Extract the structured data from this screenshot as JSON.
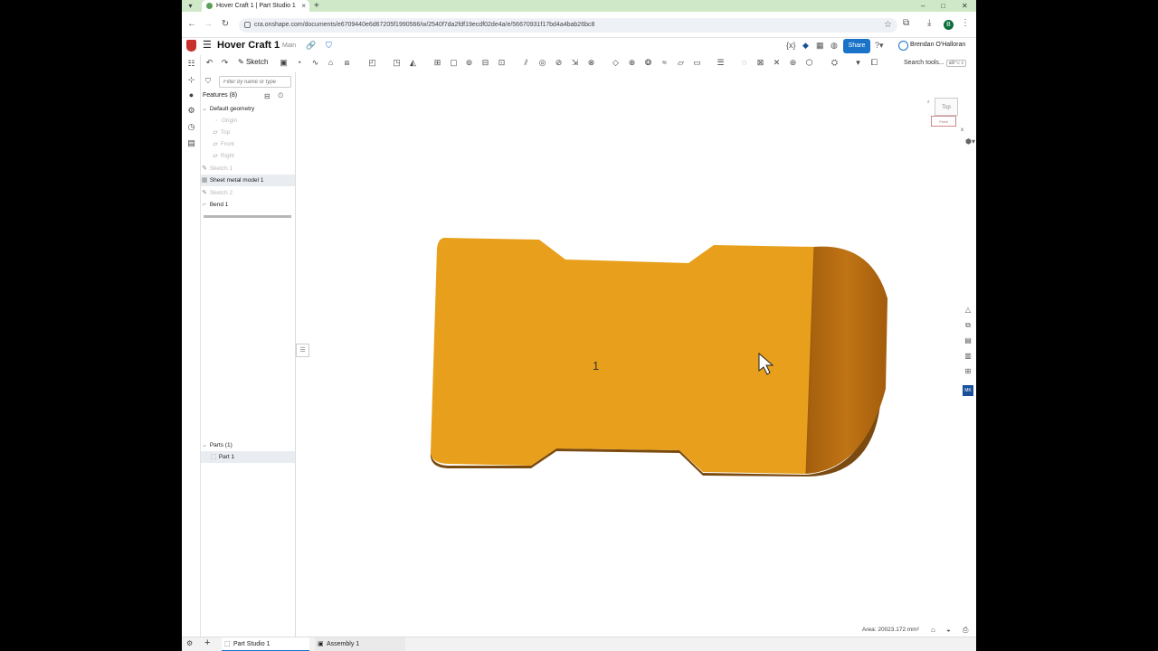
{
  "browser": {
    "tab_title": "Hover Craft 1 | Part Studio 1",
    "tab_close": "×",
    "new_tab": "+",
    "url": "cra.onshape.com/documents/e6709440e6d67205f1990566/w/2540f7da2fdf19ecdf02de4a/e/56670931f17bd4a4bab26bc8",
    "profile_initial": "B",
    "window_controls": [
      "–",
      "□",
      "✕"
    ]
  },
  "header": {
    "doc_title": "Hover Craft 1",
    "branch": "Main",
    "share_label": "Share",
    "user_name": "Brendan O'Halloran"
  },
  "toolbar": {
    "sketch_label": "Sketch",
    "search_label": "Search tools...",
    "search_shortcut": "alt/⌥ c"
  },
  "feature_panel": {
    "filter_placeholder": "Filter by name or type",
    "features_header": "Features (8)",
    "default_geometry": "Default geometry",
    "origin": "Origin",
    "top": "Top",
    "front": "Front",
    "right": "Right",
    "sketch1": "Sketch 1",
    "sheet_metal": "Sheet metal model 1",
    "sketch2": "Sketch 2",
    "bend1": "Bend 1",
    "parts_header": "Parts (1)",
    "part1": "Part 1"
  },
  "viewport": {
    "viewcube_top": "Top",
    "viewcube_front": "Front",
    "viewcube_axis_x": "x",
    "viewcube_axis_z": "z",
    "cursor_number": "1",
    "area_text": "Area: 20023.172 mm²",
    "colors": {
      "face": "#e8a01c",
      "bent_face": "#b06810",
      "edge": "#7a4a10"
    }
  },
  "bottom_tabs": {
    "part_studio": "Part Studio 1",
    "assembly": "Assembly 1"
  }
}
